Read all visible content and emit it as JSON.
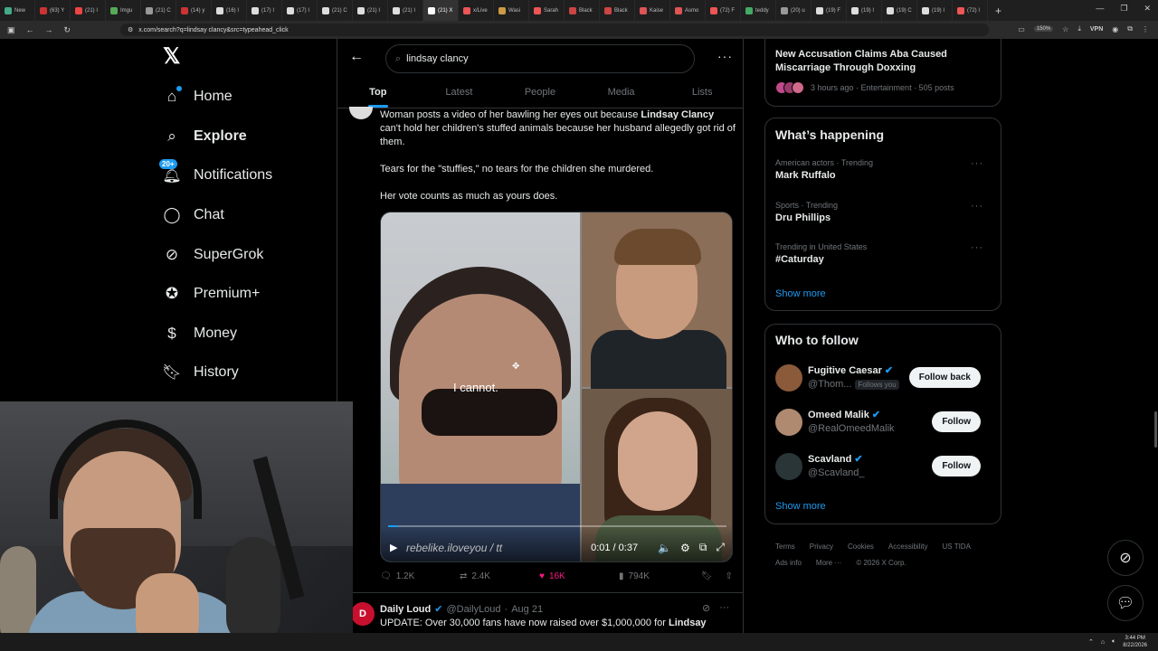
{
  "browser": {
    "tabs": [
      "New",
      "(63) Y",
      "(21) I",
      "Imgu",
      "(21) C",
      "(14) y",
      "(16) I",
      "(17) I",
      "(17) I",
      "(21) C",
      "(21) I",
      "(21) I",
      "(21) X",
      "x/Live",
      "Wasi",
      "Sarah",
      "Black",
      "Black",
      "Kaise",
      "Asmo",
      "(72) F",
      "teddy",
      "(20) u",
      "(19) F",
      "(19) I",
      "(19) C",
      "(19) I",
      "(72) I"
    ],
    "url": "x.com/search?q=lindsay clancy&src=typeahead_click",
    "zoom": "150%",
    "vpn": "VPN"
  },
  "nav": {
    "items": [
      {
        "label": "Home",
        "icon": "home-icon"
      },
      {
        "label": "Explore",
        "icon": "search-icon"
      },
      {
        "label": "Notifications",
        "icon": "bell-icon",
        "badge": "20+"
      },
      {
        "label": "Chat",
        "icon": "chat-icon"
      },
      {
        "label": "SuperGrok",
        "icon": "grok-icon"
      },
      {
        "label": "Premium+",
        "icon": "premium-icon"
      },
      {
        "label": "Money",
        "icon": "money-icon"
      },
      {
        "label": "History",
        "icon": "bookmark-icon"
      }
    ]
  },
  "search": {
    "query": "lindsay clancy",
    "tabs": [
      "Top",
      "Latest",
      "People",
      "Media",
      "Lists"
    ],
    "active_tab": "Top"
  },
  "post": {
    "text_pre": "Woman posts a video of her bawling her eyes out because ",
    "text_bold": "Lindsay Clancy",
    "text_post": " can't hold her children's stuffed animals because her husband allegedly got rid of them.",
    "line2": "Tears for the \"stuffies,\" no tears for the children she murdered.",
    "line3": "Her vote counts as much as yours does.",
    "video_caption": "I cannot.",
    "video_watermark": "rebelike.iloveyou / tt",
    "video_time": "0:01 / 0:37",
    "video_progress": 0.03,
    "replies": "1.2K",
    "reposts": "2.4K",
    "likes": "16K",
    "views": "794K"
  },
  "post2": {
    "avatar_letter": "D",
    "name": "Daily Loud",
    "handle": "@DailyLoud",
    "date": "Aug 21",
    "text_pre": "UPDATE: Over 30,000 fans have now raised over $1,000,000 for ",
    "text_bold": "Lindsay"
  },
  "right": {
    "news": {
      "title": "New Accusation Claims Aba Caused Miscarriage Through Doxxing",
      "meta": "3 hours ago · Entertainment · 505 posts"
    },
    "happening_title": "What’s happening",
    "trends": [
      {
        "context": "American actors · Trending",
        "topic": "Mark Ruffalo"
      },
      {
        "context": "Sports · Trending",
        "topic": "Dru Phillips"
      },
      {
        "context": "Trending in United States",
        "topic": "#Caturday"
      }
    ],
    "show_more": "Show more",
    "follow_title": "Who to follow",
    "follow": [
      {
        "name": "Fugitive Caesar",
        "handle": "@Thom...",
        "follows_you": "Follows you",
        "button": "Follow back",
        "color": "#8a5a3a"
      },
      {
        "name": "Omeed Malik",
        "handle": "@RealOmeedMalik",
        "follows_you": "",
        "button": "Follow",
        "color": "#b08a70"
      },
      {
        "name": "Scavland",
        "handle": "@Scavland_",
        "follows_you": "",
        "button": "Follow",
        "color": "#2a3538"
      }
    ],
    "footer": [
      "Terms",
      "Privacy",
      "Cookies",
      "Accessibility",
      "US TIDA",
      "Ads info",
      "More ···",
      "© 2026 X Corp."
    ]
  },
  "taskbar": {
    "time": "3:44 PM",
    "date": "8/22/2026"
  },
  "colors": {
    "accent": "#1d9bf0",
    "like": "#f91880",
    "bg": "#000000"
  }
}
